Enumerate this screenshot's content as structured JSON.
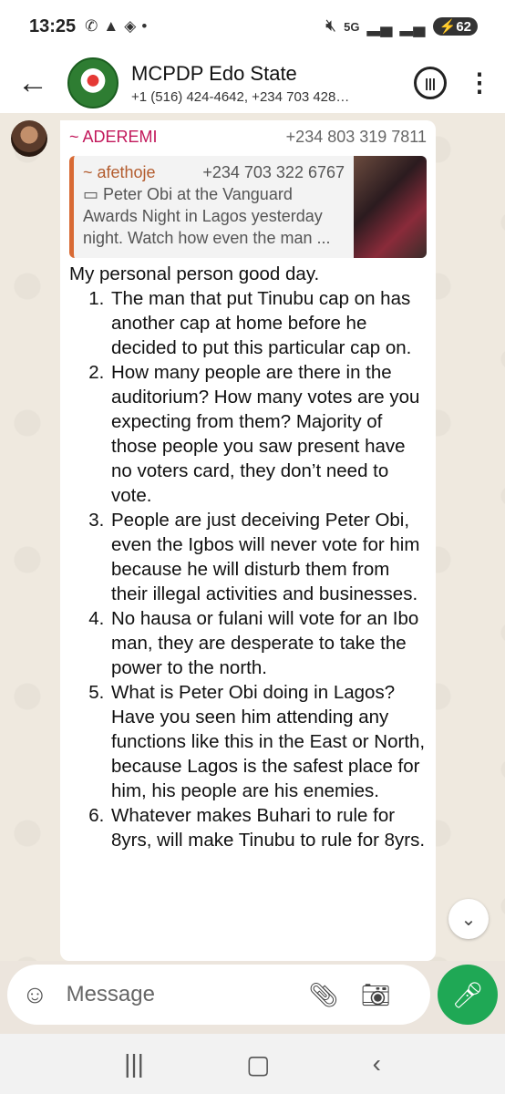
{
  "status_bar": {
    "time": "13:25",
    "battery": "62",
    "icons_left": [
      "whatsapp-icon",
      "drive-icon",
      "app-icon",
      "dot-icon"
    ],
    "icons_right": [
      "mute-icon",
      "5g-icon",
      "signal-icon",
      "signal-icon-2",
      "battery-icon"
    ]
  },
  "header": {
    "title": "MCPDP Edo State",
    "subtitle": "+1 (516) 424-4642, +234 703 428…"
  },
  "message": {
    "sender_name": "~ ADEREMI",
    "sender_phone": "+234 803 319 7811",
    "quote": {
      "author": "~ afethoje",
      "phone": "+234 703 322 6767",
      "text": "Peter Obi at the Vanguard Awards Night in Lagos yesterday night. Watch how even the man ..."
    },
    "intro": "My personal person good day.",
    "points": [
      "The man that put Tinubu cap on has another cap at home before he decided to put this particular cap on.",
      "How many people are there in the auditorium? How many votes are you expecting from them? Majority of those people you saw present have no voters card, they don’t need to vote.",
      "People are just deceiving Peter Obi, even the Igbos will never vote for him because he will disturb them from their illegal activities and businesses.",
      "No hausa or fulani will vote for an Ibo man, they are desperate to take the power to the north.",
      "What is Peter Obi doing in Lagos? Have you seen him attending any functions like this in the East or North, because Lagos is the safest place for him, his people are his enemies.",
      "Whatever makes Buhari to rule for 8yrs, will make Tinubu to rule for 8yrs."
    ]
  },
  "composer": {
    "placeholder": "Message"
  }
}
